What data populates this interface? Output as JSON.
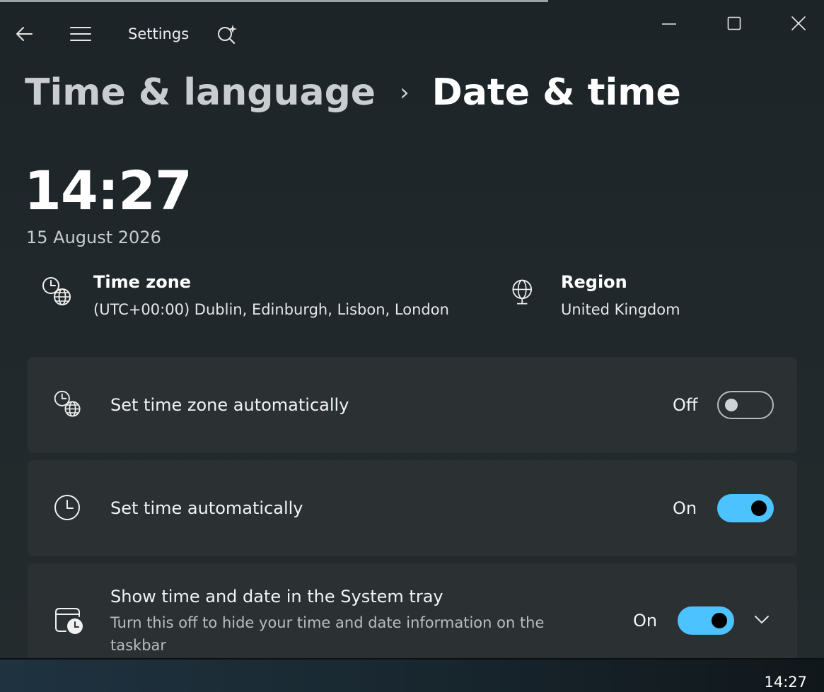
{
  "window": {
    "app_title": "Settings",
    "controls": {
      "minimize": "minimize-icon",
      "maximize": "maximize-icon",
      "close": "close-icon"
    }
  },
  "breadcrumb": {
    "parent": "Time & language",
    "current": "Date & time"
  },
  "clock": {
    "time": "14:27",
    "date": "15 August 2026"
  },
  "time_zone": {
    "label": "Time zone",
    "value": "(UTC+00:00) Dublin, Edinburgh, Lisbon, London"
  },
  "region": {
    "label": "Region",
    "value": "United Kingdom"
  },
  "settings": [
    {
      "title": "Set time zone automatically",
      "state": "Off",
      "on": false,
      "icon": "clock-globe-icon"
    },
    {
      "title": "Set time automatically",
      "state": "On",
      "on": true,
      "icon": "clock-icon"
    },
    {
      "title": "Show time and date in the System tray",
      "subtitle": "Turn this off to hide your time and date information on the taskbar",
      "state": "On",
      "on": true,
      "icon": "calendar-clock-icon"
    }
  ],
  "taskbar": {
    "clock": "14:27"
  },
  "colors": {
    "accent": "#4cc2ff",
    "background": "#1c2226",
    "card": "#2b3133"
  }
}
